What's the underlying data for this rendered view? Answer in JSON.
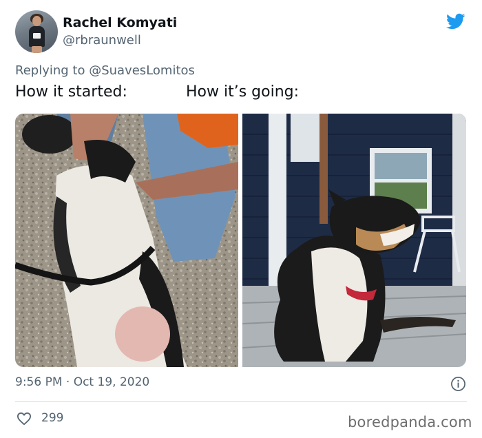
{
  "tweet": {
    "author": {
      "display_name": "Rachel Komyati",
      "handle": "@rbraunwell",
      "avatar_icon": "avatar-photo"
    },
    "platform_icon": "twitter-bird-icon",
    "brand_color": "#1d9bf0",
    "replying_prefix": "Replying to",
    "replying_to": "@SuavesLomitos",
    "text_left": "How it started:",
    "text_right": "How it’s going:",
    "images": [
      {
        "name": "puppy-on-back-photo"
      },
      {
        "name": "adult-dog-on-porch-photo"
      }
    ],
    "timestamp": "9:56 PM · Oct 19, 2020",
    "info_icon": "info-icon",
    "likes": {
      "icon": "heart-icon",
      "count": "299"
    }
  },
  "watermark": "boredpanda.com"
}
